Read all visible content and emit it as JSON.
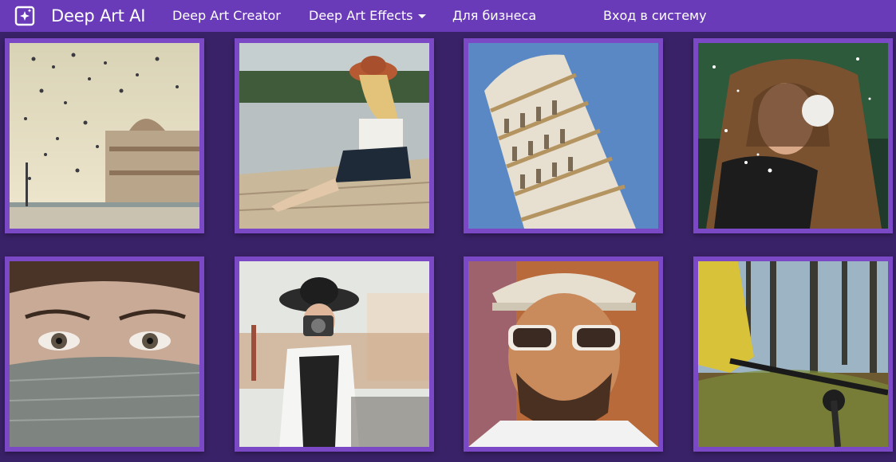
{
  "navbar": {
    "brand_name": "Deep Art AI",
    "links": {
      "creator": "Deep Art Creator",
      "effects": "Deep Art Effects",
      "business": "Для бизнеса",
      "login": "Вход в систему"
    }
  },
  "colors": {
    "navbar_bg": "#6a3bb8",
    "page_bg": "#3a2268",
    "tile_frame": "#7b48c6"
  },
  "gallery": {
    "items": [
      {
        "subject": "birds-over-palace"
      },
      {
        "subject": "woman-on-pier"
      },
      {
        "subject": "leaning-tower"
      },
      {
        "subject": "girl-in-snow"
      },
      {
        "subject": "eyes-portrait"
      },
      {
        "subject": "photographer-woman"
      },
      {
        "subject": "man-in-sunglasses"
      },
      {
        "subject": "mountain-biker"
      }
    ]
  }
}
